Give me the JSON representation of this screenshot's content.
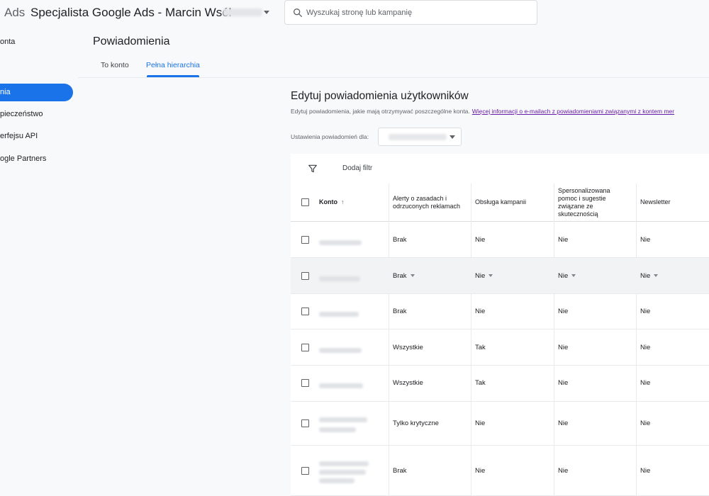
{
  "app": {
    "brand": "Ads",
    "account_title": "Specjalista Google Ads - Marcin Wsół"
  },
  "search": {
    "placeholder": "Wyszukaj stronę lub kampanię",
    "icon": "search-icon"
  },
  "sidebar": {
    "items": [
      {
        "label": "onta",
        "active": false
      },
      {
        "label": "nia",
        "active": true
      },
      {
        "label": "pieczeństwo",
        "active": false
      },
      {
        "label": "erfejsu API",
        "active": false
      },
      {
        "label": "ogle Partners",
        "active": false
      }
    ]
  },
  "header": {
    "title": "Powiadomienia",
    "tabs": [
      {
        "label": "To konto",
        "active": false
      },
      {
        "label": "Pełna hierarchia",
        "active": true
      }
    ]
  },
  "section": {
    "title": "Edytuj powiadomienia użytkowników",
    "description": "Edytuj powiadomienia, jakie mają otrzymywać poszczególne konta.",
    "link": "Więcej informacji o e-mailach z powiadomieniami związanymi z kontem mer",
    "settings_label": "Ustawienia powiadomień dla:"
  },
  "table": {
    "filter_label": "Dodaj filtr",
    "columns": [
      {
        "label": "Konto",
        "sort": "↑"
      },
      {
        "label": "Alerty o zasadach i odrzuconych reklamach"
      },
      {
        "label": "Obsługa kampanii"
      },
      {
        "label": "Spersonalizowana pomoc i sugestie związane ze skutecznością"
      },
      {
        "label": "Newsletter"
      }
    ],
    "rows": [
      {
        "alerts": "Brak",
        "campaign": "Nie",
        "perf": "Nie",
        "newsletter": "Nie"
      },
      {
        "alerts": "Brak",
        "campaign": "Nie",
        "perf": "Nie",
        "newsletter": "Nie"
      },
      {
        "alerts": "Brak",
        "campaign": "Nie",
        "perf": "Nie",
        "newsletter": "Nie"
      },
      {
        "alerts": "Wszystkie",
        "campaign": "Tak",
        "perf": "Nie",
        "newsletter": "Nie"
      },
      {
        "alerts": "Wszystkie",
        "campaign": "Tak",
        "perf": "Nie",
        "newsletter": "Nie"
      },
      {
        "alerts": "Tylko krytyczne",
        "campaign": "Nie",
        "perf": "Nie",
        "newsletter": "Nie"
      },
      {
        "alerts": "Brak",
        "campaign": "Nie",
        "perf": "Nie",
        "newsletter": "Nie"
      }
    ]
  },
  "colors": {
    "accent": "#1a73e8",
    "link": "#681da8",
    "hover_row": "#f1f3f4"
  }
}
